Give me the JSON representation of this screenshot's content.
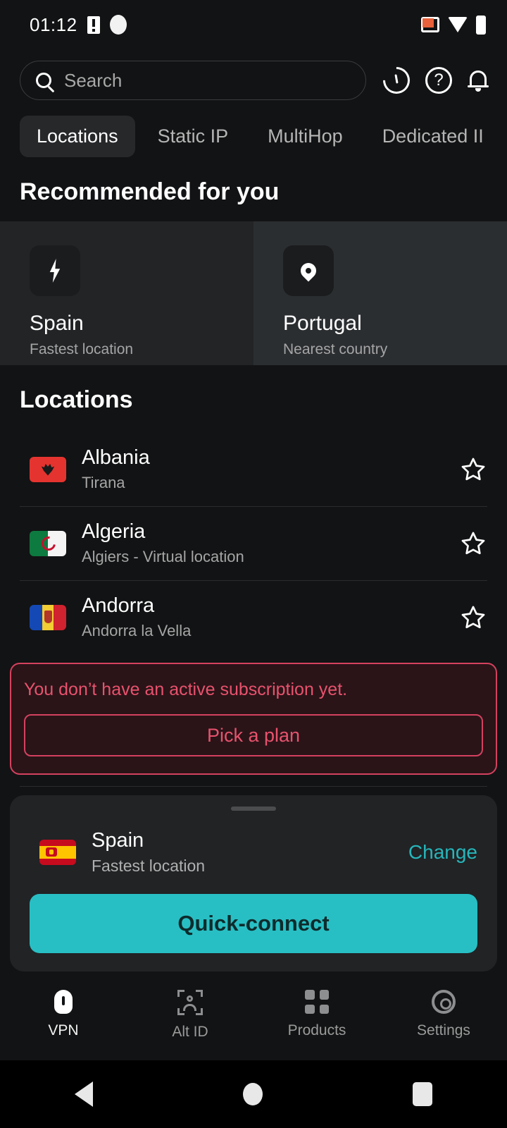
{
  "statusbar": {
    "time": "01:12",
    "icons": [
      "sim-card-icon",
      "recording-dot-icon",
      "cast-icon",
      "wifi-icon",
      "battery-icon"
    ]
  },
  "search": {
    "placeholder": "Search",
    "value": "",
    "icons": [
      "search-icon",
      "speedometer-icon",
      "help-circle-icon",
      "bell-icon"
    ]
  },
  "tabs": [
    {
      "label": "Locations",
      "active": true
    },
    {
      "label": "Static IP",
      "active": false
    },
    {
      "label": "MultiHop",
      "active": false
    },
    {
      "label": "Dedicated II",
      "active": false
    }
  ],
  "recommended": {
    "title": "Recommended for you",
    "cards": [
      {
        "icon": "lightning-bolt-icon",
        "name": "Spain",
        "subtitle": "Fastest location"
      },
      {
        "icon": "map-pin-icon",
        "name": "Portugal",
        "subtitle": "Nearest country"
      }
    ]
  },
  "locations": {
    "title": "Locations",
    "items": [
      {
        "country": "Albania",
        "city": "Tirana",
        "flag": "albania-flag",
        "favorite": false
      },
      {
        "country": "Algeria",
        "city": "Algiers - Virtual location",
        "flag": "algeria-flag",
        "favorite": false
      },
      {
        "country": "Andorra",
        "city": "Andorra la Vella",
        "flag": "andorra-flag",
        "favorite": false
      }
    ]
  },
  "subscription_alert": {
    "message": "You don’t have an active subscription yet.",
    "button_label": "Pick a plan",
    "border_color": "#d4415f",
    "background_color": "#2a1418",
    "text_color": "#e8526d"
  },
  "bottom_sheet": {
    "location_name": "Spain",
    "location_subtitle": "Fastest location",
    "change_label": "Change",
    "connect_label": "Quick-connect",
    "accent_color": "#28bfc4",
    "change_color": "#26b6bb"
  },
  "bottom_nav": [
    {
      "label": "VPN",
      "icon": "shield-icon",
      "active": true
    },
    {
      "label": "Alt ID",
      "icon": "identity-scan-icon",
      "active": false
    },
    {
      "label": "Products",
      "icon": "grid-apps-icon",
      "active": false
    },
    {
      "label": "Settings",
      "icon": "gear-icon",
      "active": false
    }
  ],
  "android_nav": [
    {
      "label": "Back",
      "icon": "back-triangle-icon"
    },
    {
      "label": "Home",
      "icon": "home-circle-icon"
    },
    {
      "label": "Recents",
      "icon": "recents-square-icon"
    }
  ]
}
